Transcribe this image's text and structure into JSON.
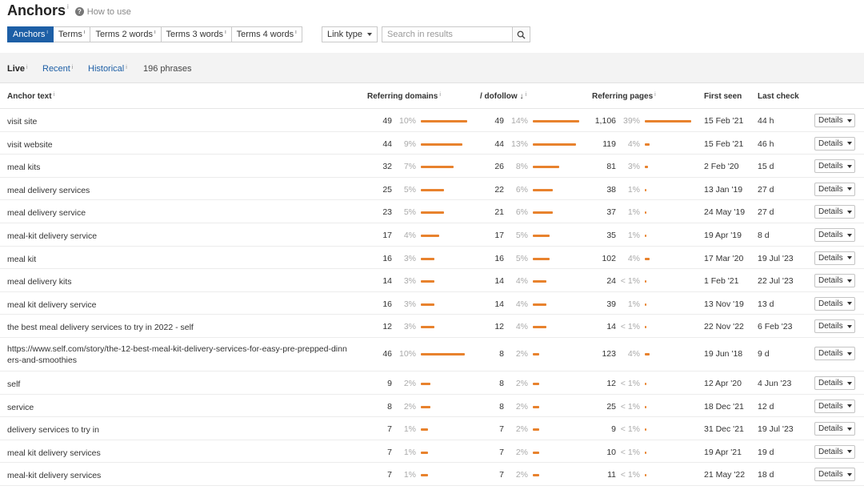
{
  "header": {
    "title": "Anchors",
    "title_info": "i",
    "howto_icon": "question-icon",
    "howto_label": "How to use"
  },
  "tabs": [
    {
      "label": "Anchors",
      "sup": "i",
      "active": true
    },
    {
      "label": "Terms",
      "sup": "i",
      "active": false
    },
    {
      "label": "Terms 2 words",
      "sup": "i",
      "active": false
    },
    {
      "label": "Terms 3 words",
      "sup": "i",
      "active": false
    },
    {
      "label": "Terms 4 words",
      "sup": "i",
      "active": false
    }
  ],
  "filters": {
    "link_type_label": "Link type",
    "search_placeholder": "Search in results",
    "search_icon": "search-icon"
  },
  "subtabs": [
    {
      "label": "Live",
      "sup": "i",
      "active": true
    },
    {
      "label": "Recent",
      "sup": "i",
      "active": false
    },
    {
      "label": "Historical",
      "sup": "i",
      "active": false
    }
  ],
  "phrases_count": "196 phrases",
  "columns": {
    "anchor_text": "Anchor text",
    "referring_domains": "Referring domains",
    "dofollow": "/ dofollow",
    "dofollow_sort": "↓",
    "referring_pages": "Referring pages",
    "first_seen": "First seen",
    "last_check": "Last check",
    "info": "i"
  },
  "details_label": "Details",
  "colors": {
    "accent": "#1d5fa6",
    "bar": "#e8822d"
  },
  "rows": [
    {
      "anchor": "visit site",
      "rd": "49",
      "rd_pct": "10%",
      "rd_share": 10,
      "df": "49",
      "df_pct": "14%",
      "df_share": 14,
      "rp": "1,106",
      "rp_pct": "39%",
      "rp_share": 39,
      "first_seen": "15 Feb '21",
      "last_check": "44 h"
    },
    {
      "anchor": "visit website",
      "rd": "44",
      "rd_pct": "9%",
      "rd_share": 9,
      "df": "44",
      "df_pct": "13%",
      "df_share": 13,
      "rp": "119",
      "rp_pct": "4%",
      "rp_share": 4,
      "first_seen": "15 Feb '21",
      "last_check": "46 h"
    },
    {
      "anchor": "meal kits",
      "rd": "32",
      "rd_pct": "7%",
      "rd_share": 7,
      "df": "26",
      "df_pct": "8%",
      "df_share": 8,
      "rp": "81",
      "rp_pct": "3%",
      "rp_share": 3,
      "first_seen": "2 Feb '20",
      "last_check": "15 d"
    },
    {
      "anchor": "meal delivery services",
      "rd": "25",
      "rd_pct": "5%",
      "rd_share": 5,
      "df": "22",
      "df_pct": "6%",
      "df_share": 6,
      "rp": "38",
      "rp_pct": "1%",
      "rp_share": 1,
      "first_seen": "13 Jan '19",
      "last_check": "27 d"
    },
    {
      "anchor": "meal delivery service",
      "rd": "23",
      "rd_pct": "5%",
      "rd_share": 5,
      "df": "21",
      "df_pct": "6%",
      "df_share": 6,
      "rp": "37",
      "rp_pct": "1%",
      "rp_share": 1,
      "first_seen": "24 May '19",
      "last_check": "27 d"
    },
    {
      "anchor": "meal-kit delivery service",
      "rd": "17",
      "rd_pct": "4%",
      "rd_share": 4,
      "df": "17",
      "df_pct": "5%",
      "df_share": 5,
      "rp": "35",
      "rp_pct": "1%",
      "rp_share": 1,
      "first_seen": "19 Apr '19",
      "last_check": "8 d"
    },
    {
      "anchor": "meal kit",
      "rd": "16",
      "rd_pct": "3%",
      "rd_share": 3,
      "df": "16",
      "df_pct": "5%",
      "df_share": 5,
      "rp": "102",
      "rp_pct": "4%",
      "rp_share": 4,
      "first_seen": "17 Mar '20",
      "last_check": "19 Jul '23"
    },
    {
      "anchor": "meal delivery kits",
      "rd": "14",
      "rd_pct": "3%",
      "rd_share": 3,
      "df": "14",
      "df_pct": "4%",
      "df_share": 4,
      "rp": "24",
      "rp_pct": "< 1%",
      "rp_share": 0.5,
      "first_seen": "1 Feb '21",
      "last_check": "22 Jul '23"
    },
    {
      "anchor": "meal kit delivery service",
      "rd": "16",
      "rd_pct": "3%",
      "rd_share": 3,
      "df": "14",
      "df_pct": "4%",
      "df_share": 4,
      "rp": "39",
      "rp_pct": "1%",
      "rp_share": 1,
      "first_seen": "13 Nov '19",
      "last_check": "13 d"
    },
    {
      "anchor": "the best meal delivery services to try in 2022 - self",
      "rd": "12",
      "rd_pct": "3%",
      "rd_share": 3,
      "df": "12",
      "df_pct": "4%",
      "df_share": 4,
      "rp": "14",
      "rp_pct": "< 1%",
      "rp_share": 0.5,
      "first_seen": "22 Nov '22",
      "last_check": "6 Feb '23"
    },
    {
      "anchor": "https://www.self.com/story/the-12-best-meal-kit-delivery-services-for-easy-pre-prepped-dinn ers-and-smoothies",
      "rd": "46",
      "rd_pct": "10%",
      "rd_share": 9.5,
      "df": "8",
      "df_pct": "2%",
      "df_share": 2,
      "rp": "123",
      "rp_pct": "4%",
      "rp_share": 4,
      "first_seen": "19 Jun '18",
      "last_check": "9 d"
    },
    {
      "anchor": "self",
      "rd": "9",
      "rd_pct": "2%",
      "rd_share": 2,
      "df": "8",
      "df_pct": "2%",
      "df_share": 2,
      "rp": "12",
      "rp_pct": "< 1%",
      "rp_share": 0.5,
      "first_seen": "12 Apr '20",
      "last_check": "4 Jun '23"
    },
    {
      "anchor": "service",
      "rd": "8",
      "rd_pct": "2%",
      "rd_share": 2,
      "df": "8",
      "df_pct": "2%",
      "df_share": 2,
      "rp": "25",
      "rp_pct": "< 1%",
      "rp_share": 0.5,
      "first_seen": "18 Dec '21",
      "last_check": "12 d"
    },
    {
      "anchor": "delivery services to try in",
      "rd": "7",
      "rd_pct": "1%",
      "rd_share": 1.5,
      "df": "7",
      "df_pct": "2%",
      "df_share": 2,
      "rp": "9",
      "rp_pct": "< 1%",
      "rp_share": 0.5,
      "first_seen": "31 Dec '21",
      "last_check": "19 Jul '23"
    },
    {
      "anchor": "meal kit delivery services",
      "rd": "7",
      "rd_pct": "1%",
      "rd_share": 1.5,
      "df": "7",
      "df_pct": "2%",
      "df_share": 2,
      "rp": "10",
      "rp_pct": "< 1%",
      "rp_share": 0.5,
      "first_seen": "19 Apr '21",
      "last_check": "19 d"
    },
    {
      "anchor": "meal-kit delivery services",
      "rd": "7",
      "rd_pct": "1%",
      "rd_share": 1.5,
      "df": "7",
      "df_pct": "2%",
      "df_share": 2,
      "rp": "11",
      "rp_pct": "< 1%",
      "rp_share": 0.5,
      "first_seen": "21 May '22",
      "last_check": "18 d"
    }
  ]
}
